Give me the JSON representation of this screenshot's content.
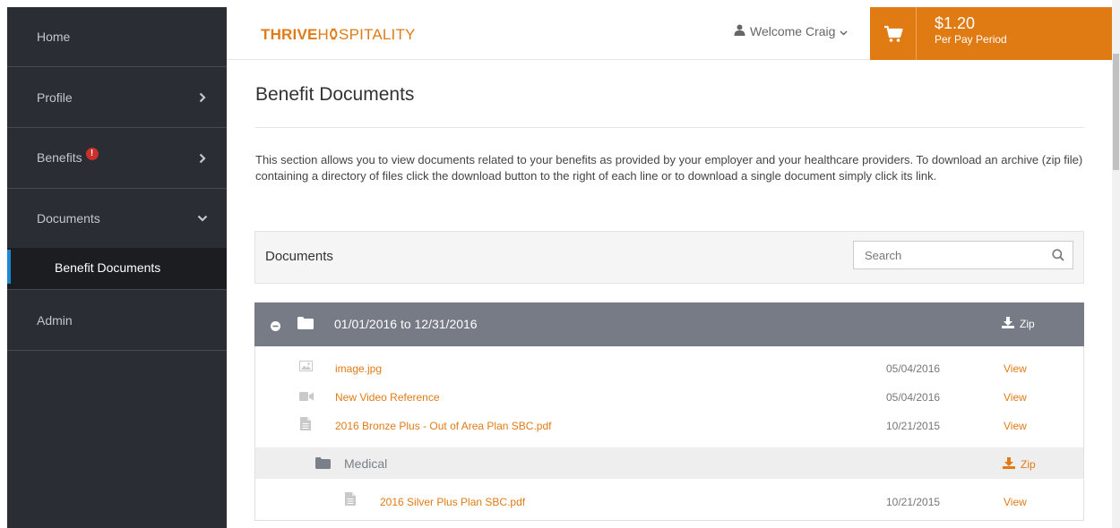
{
  "sidebar": {
    "items": [
      {
        "label": "Home"
      },
      {
        "label": "Profile"
      },
      {
        "label": "Benefits",
        "badge": "!"
      },
      {
        "label": "Documents",
        "children": [
          {
            "label": "Benefit Documents"
          }
        ]
      },
      {
        "label": "Admin"
      }
    ]
  },
  "header": {
    "logo_part1": "THRIVE",
    "logo_part2": "H",
    "logo_part3": "SPITALITY",
    "welcome": "Welcome Craig",
    "cart": {
      "price": "$1.20",
      "period": "Per Pay Period"
    }
  },
  "main": {
    "title": "Benefit Documents",
    "intro": "This section allows you to view documents related to your benefits as provided by your employer and your healthcare providers. To download an archive (zip file) containing a directory of files click the download button to the right of each line or to download a single document simply click its link.",
    "documents_panel": {
      "title": "Documents",
      "search_placeholder": "Search"
    },
    "folder": {
      "label": "01/01/2016 to 12/31/2016",
      "zip_label": "Zip",
      "files": [
        {
          "name": "image.jpg",
          "date": "05/04/2016",
          "action": "View",
          "icon": "image-icon"
        },
        {
          "name": "New Video Reference",
          "date": "05/04/2016",
          "action": "View",
          "icon": "video-icon"
        },
        {
          "name": "2016 Bronze Plus - Out of Area Plan SBC.pdf",
          "date": "10/21/2015",
          "action": "View",
          "icon": "document-icon"
        }
      ],
      "subfolder": {
        "label": "Medical",
        "zip_label": "Zip",
        "files": [
          {
            "name": "2016 Silver Plus Plan SBC.pdf",
            "date": "10/21/2015",
            "action": "View",
            "icon": "document-icon"
          }
        ]
      }
    }
  },
  "colors": {
    "accent": "#e07b15",
    "sidebar": "#2a2d33",
    "folder_header": "#767b85",
    "badge": "#c9302c",
    "active_marker": "#1e88d6"
  }
}
